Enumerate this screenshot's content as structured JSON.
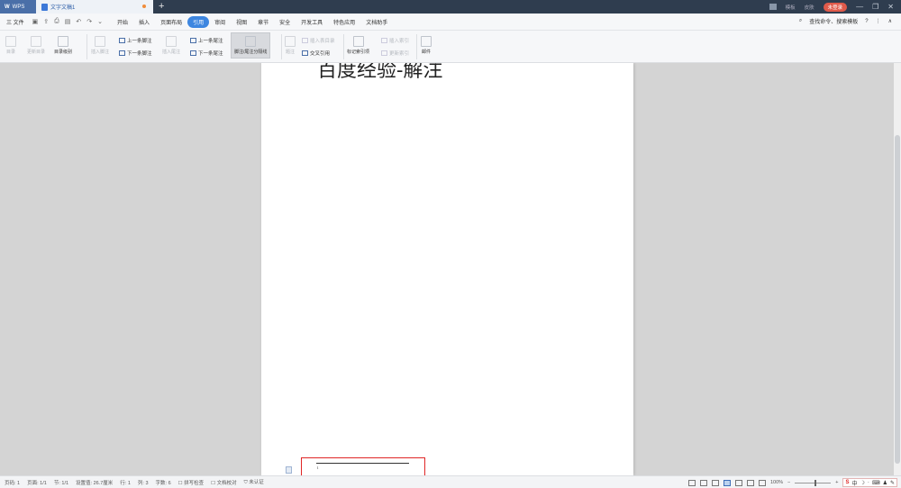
{
  "titlebar": {
    "app_tab": "WPS",
    "doc_tab": "文字文稿1",
    "new_tab": "+",
    "right_items": [
      "模板",
      "皮肤"
    ],
    "login_label": "未登录",
    "minimize": "—",
    "restore": "❐",
    "close": "✕"
  },
  "menubar": {
    "file_label": "三 文件",
    "tabs": [
      "开始",
      "插入",
      "页面布局",
      "引用",
      "审阅",
      "视图",
      "章节",
      "安全",
      "开发工具",
      "特色应用",
      "文档助手"
    ],
    "active_tab": "引用",
    "search_label": "查找命令、搜索模板",
    "help": "?",
    "more": "⋮",
    "collapse": "∧"
  },
  "ribbon": {
    "toc": "目录",
    "update_toc": "更新目录",
    "toc_level": "目录级别",
    "insert_footnote": "插入脚注",
    "prev_footnote": "上一条脚注",
    "next_footnote": "下一条脚注",
    "insert_endnote": "插入尾注",
    "prev_endnote": "上一条尾注",
    "next_endnote": "下一条尾注",
    "footnote_separator": "脚注/尾注分隔线",
    "caption": "题注",
    "insert_table_of_figures": "插入表目录",
    "cross_reference": "交叉引用",
    "mark_index_entry": "标记索引项",
    "insert_index": "插入索引",
    "update_index": "更新索引",
    "mail": "邮件"
  },
  "document": {
    "heading": "百度经验-解注",
    "footnote_mark": "ɩ"
  },
  "statusbar": {
    "page_num": "页码: 1",
    "pages": "页面: 1/1",
    "section": "节: 1/1",
    "setting": "设置值: 26.7厘米",
    "row": "行: 1",
    "col": "列: 3",
    "word_count": "字数: 6",
    "spell_check": "拼写检查",
    "doc_proof": "文档校对",
    "not_certified": "未认证",
    "zoom": "100%",
    "zoom_minus": "−",
    "zoom_plus": "+",
    "ime_lang": "中",
    "ime_s": "S"
  }
}
